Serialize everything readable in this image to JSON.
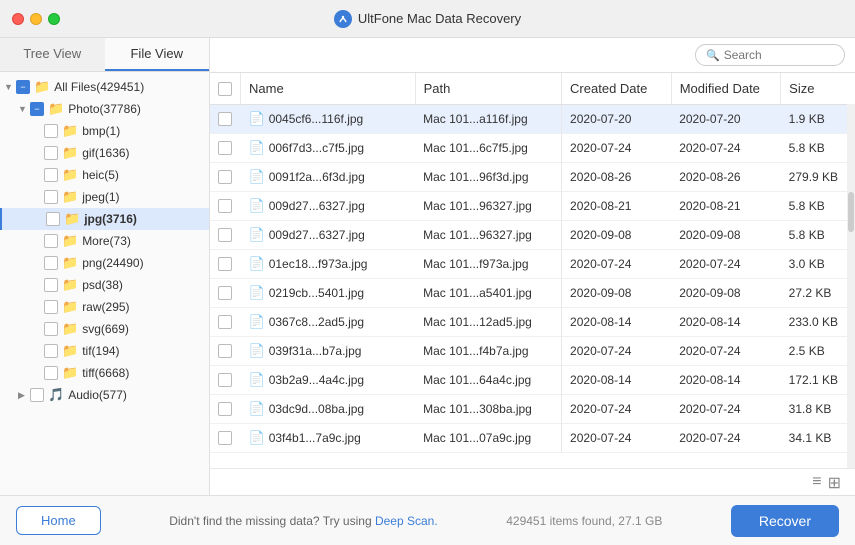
{
  "titleBar": {
    "appName": "UltFone Mac Data Recovery",
    "appIconLabel": "U"
  },
  "tabs": [
    {
      "id": "tree",
      "label": "Tree View",
      "active": false
    },
    {
      "id": "file",
      "label": "File View",
      "active": true
    }
  ],
  "sidebar": {
    "items": [
      {
        "id": "all-files",
        "label": "All Files(429451)",
        "indent": 0,
        "type": "root",
        "expanded": true,
        "checked": "partial"
      },
      {
        "id": "photo",
        "label": "Photo(37786)",
        "indent": 1,
        "type": "folder",
        "expanded": true,
        "checked": "partial"
      },
      {
        "id": "bmp",
        "label": "bmp(1)",
        "indent": 2,
        "type": "folder",
        "checked": "false"
      },
      {
        "id": "gif",
        "label": "gif(1636)",
        "indent": 2,
        "type": "folder",
        "checked": "false"
      },
      {
        "id": "heic",
        "label": "heic(5)",
        "indent": 2,
        "type": "folder",
        "checked": "false"
      },
      {
        "id": "jpeg",
        "label": "jpeg(1)",
        "indent": 2,
        "type": "folder",
        "checked": "false"
      },
      {
        "id": "jpg",
        "label": "jpg(3716)",
        "indent": 2,
        "type": "folder",
        "checked": "false",
        "selected": true
      },
      {
        "id": "more",
        "label": "More(73)",
        "indent": 2,
        "type": "folder",
        "checked": "false"
      },
      {
        "id": "png",
        "label": "png(24490)",
        "indent": 2,
        "type": "folder",
        "checked": "false"
      },
      {
        "id": "psd",
        "label": "psd(38)",
        "indent": 2,
        "type": "folder",
        "checked": "false"
      },
      {
        "id": "raw",
        "label": "raw(295)",
        "indent": 2,
        "type": "folder",
        "checked": "false"
      },
      {
        "id": "svg",
        "label": "svg(669)",
        "indent": 2,
        "type": "folder",
        "checked": "false"
      },
      {
        "id": "tif",
        "label": "tif(194)",
        "indent": 2,
        "type": "folder",
        "checked": "false"
      },
      {
        "id": "tiff",
        "label": "tiff(6668)",
        "indent": 2,
        "type": "folder",
        "checked": "false"
      },
      {
        "id": "audio",
        "label": "Audio(577)",
        "indent": 1,
        "type": "folder",
        "expanded": false,
        "checked": "false"
      }
    ]
  },
  "table": {
    "columns": [
      {
        "id": "checkbox",
        "label": ""
      },
      {
        "id": "name",
        "label": "Name"
      },
      {
        "id": "path",
        "label": "Path"
      },
      {
        "id": "created",
        "label": "Created Date"
      },
      {
        "id": "modified",
        "label": "Modified Date"
      },
      {
        "id": "size",
        "label": "Size"
      }
    ],
    "rows": [
      {
        "id": 1,
        "name": "0045cf6...116f.jpg",
        "path": "Mac 101...a116f.jpg",
        "created": "2020-07-20",
        "modified": "2020-07-20",
        "size": "1.9 KB",
        "selected": true
      },
      {
        "id": 2,
        "name": "006f7d3...c7f5.jpg",
        "path": "Mac 101...6c7f5.jpg",
        "created": "2020-07-24",
        "modified": "2020-07-24",
        "size": "5.8 KB"
      },
      {
        "id": 3,
        "name": "0091f2a...6f3d.jpg",
        "path": "Mac 101...96f3d.jpg",
        "created": "2020-08-26",
        "modified": "2020-08-26",
        "size": "279.9 KB"
      },
      {
        "id": 4,
        "name": "009d27...6327.jpg",
        "path": "Mac 101...96327.jpg",
        "created": "2020-08-21",
        "modified": "2020-08-21",
        "size": "5.8 KB"
      },
      {
        "id": 5,
        "name": "009d27...6327.jpg",
        "path": "Mac 101...96327.jpg",
        "created": "2020-09-08",
        "modified": "2020-09-08",
        "size": "5.8 KB"
      },
      {
        "id": 6,
        "name": "01ec18...f973a.jpg",
        "path": "Mac 101...f973a.jpg",
        "created": "2020-07-24",
        "modified": "2020-07-24",
        "size": "3.0 KB"
      },
      {
        "id": 7,
        "name": "0219cb...5401.jpg",
        "path": "Mac 101...a5401.jpg",
        "created": "2020-09-08",
        "modified": "2020-09-08",
        "size": "27.2 KB"
      },
      {
        "id": 8,
        "name": "0367c8...2ad5.jpg",
        "path": "Mac 101...12ad5.jpg",
        "created": "2020-08-14",
        "modified": "2020-08-14",
        "size": "233.0 KB"
      },
      {
        "id": 9,
        "name": "039f31a...b7a.jpg",
        "path": "Mac 101...f4b7a.jpg",
        "created": "2020-07-24",
        "modified": "2020-07-24",
        "size": "2.5 KB"
      },
      {
        "id": 10,
        "name": "03b2a9...4a4c.jpg",
        "path": "Mac 101...64a4c.jpg",
        "created": "2020-08-14",
        "modified": "2020-08-14",
        "size": "172.1 KB"
      },
      {
        "id": 11,
        "name": "03dc9d...08ba.jpg",
        "path": "Mac 101...308ba.jpg",
        "created": "2020-07-24",
        "modified": "2020-07-24",
        "size": "31.8 KB"
      },
      {
        "id": 12,
        "name": "03f4b1...7a9c.jpg",
        "path": "Mac 101...07a9c.jpg",
        "created": "2020-07-24",
        "modified": "2020-07-24",
        "size": "34.1 KB"
      }
    ]
  },
  "toolbar": {
    "searchPlaceholder": "Search"
  },
  "bottomBar": {
    "homeLabel": "Home",
    "hintText": "Didn't find the missing data? Try using",
    "deepScanLabel": "Deep Scan.",
    "statsText": "429451 items found, 27.1 GB",
    "recoverLabel": "Recover"
  }
}
